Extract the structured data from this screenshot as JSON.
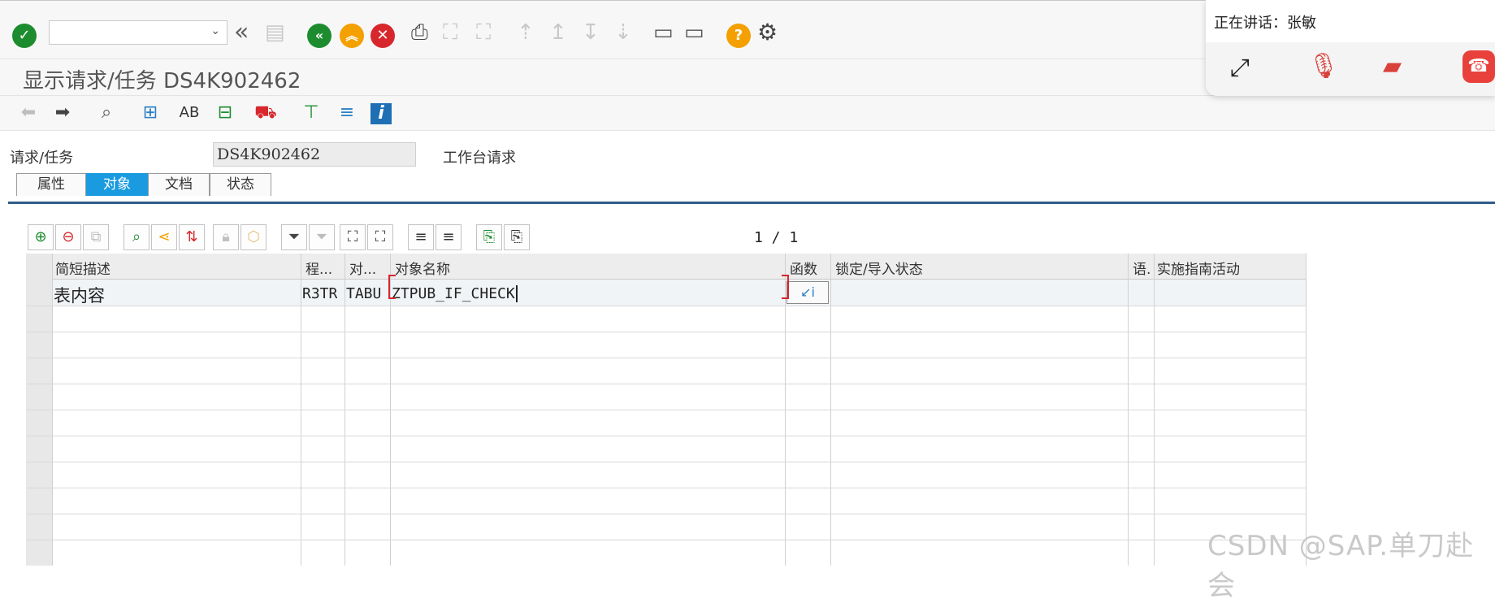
{
  "command_field": {
    "value": ""
  },
  "title": "显示请求/任务 DS4K902462",
  "request": {
    "label": "请求/任务",
    "value": "DS4K902462",
    "description": "工作台请求"
  },
  "tabs": [
    {
      "label": "属性",
      "active": false
    },
    {
      "label": "对象",
      "active": true
    },
    {
      "label": "文档",
      "active": false
    },
    {
      "label": "状态",
      "active": false
    }
  ],
  "table": {
    "page_indicator": "1 / 1",
    "columns": [
      "简短描述",
      "程...",
      "对...",
      "对象名称",
      "函数",
      "锁定/导入状态",
      "语.",
      "实施指南活动"
    ],
    "rows": [
      {
        "short_desc": "表内容",
        "program_id": "R3TR",
        "object_type": "TABU",
        "object_name": "ZTPUB_IF_CHECK",
        "function": "",
        "lock_status": "",
        "lang": "",
        "activity": ""
      }
    ]
  },
  "call_overlay": {
    "speaking": "正在讲话：张敏",
    "colors": {
      "end_call": "#e8413b",
      "muted": "#d9413b"
    }
  },
  "watermark": "CSDN @SAP.单刀赴会",
  "colors": {
    "tab_active": "#1a9be0",
    "ok_green": "#1c8c2e",
    "nav_green": "#1c8c2e",
    "orange": "#f3a000",
    "cancel_red": "#d7272d",
    "help_orange": "#f3a000"
  }
}
